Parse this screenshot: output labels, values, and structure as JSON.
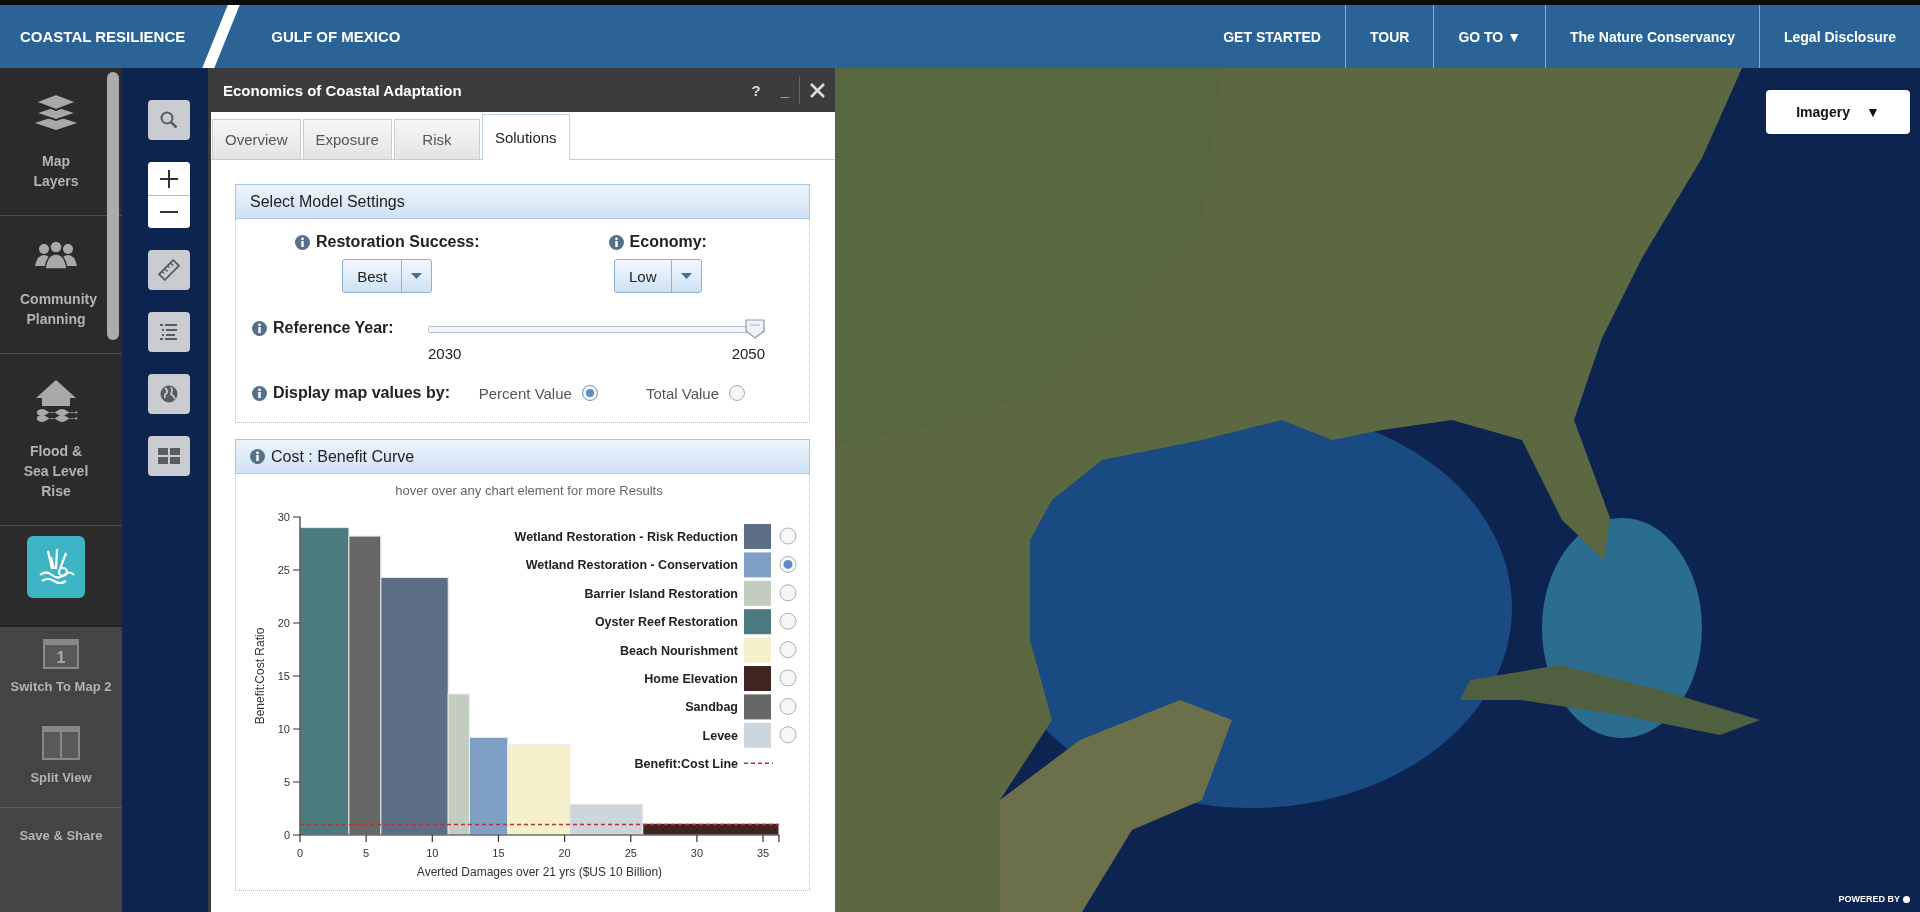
{
  "header": {
    "brand": "COASTAL RESILIENCE",
    "region": "GULF OF MEXICO",
    "nav": [
      {
        "label": "GET STARTED"
      },
      {
        "label": "TOUR"
      },
      {
        "label": "GO TO ▼"
      },
      {
        "label": "The Nature Conservancy"
      },
      {
        "label": "Legal Disclosure"
      }
    ]
  },
  "sidebar": {
    "items": [
      {
        "kind": "layers",
        "label": "Map Layers",
        "selected": false
      },
      {
        "kind": "people",
        "label": "Community Planning",
        "selected": false
      },
      {
        "kind": "flood",
        "label": "Flood & Sea Level Rise",
        "selected": false
      },
      {
        "kind": "coastal",
        "selected": true
      }
    ],
    "actions": [
      {
        "kind": "map_switch",
        "label": "Switch To Map 2",
        "badge": "1"
      },
      {
        "kind": "split",
        "label": "Split View"
      },
      {
        "kind": "text",
        "label": "Save & Share"
      }
    ]
  },
  "tools": [
    {
      "kind": "search"
    },
    {
      "kind": "zoom"
    },
    {
      "kind": "measure"
    },
    {
      "kind": "legend"
    },
    {
      "kind": "basemap"
    },
    {
      "kind": "grid"
    }
  ],
  "map": {
    "basemap_button": {
      "label": "Imagery",
      "caret": "▼"
    },
    "credit": "POWERED BY"
  },
  "panel": {
    "title": "Economics of Coastal Adaptation",
    "help": "?",
    "minimize": "_",
    "tabs": [
      {
        "label": "Overview",
        "selected": false
      },
      {
        "label": "Exposure",
        "selected": false
      },
      {
        "label": "Risk",
        "selected": false
      },
      {
        "label": "Solutions",
        "selected": true
      }
    ],
    "settings": {
      "title": "Select Model Settings",
      "restoration_success": {
        "label": "Restoration Success:",
        "value": "Best"
      },
      "economy": {
        "label": "Economy:",
        "value": "Low"
      },
      "reference_year": {
        "label": "Reference Year:",
        "min_label": "2030",
        "max_label": "2050",
        "level": 1
      },
      "display_by": {
        "label": "Display map values by:",
        "options": [
          {
            "label": "Percent Value",
            "selected": true
          },
          {
            "label": "Total Value",
            "selected": false
          }
        ]
      }
    },
    "chart": {
      "title": "Cost : Benefit Curve",
      "hint": "hover over any chart element for more Results",
      "chart_data": {
        "type": "bar",
        "xlabel": "Averted Damages over 21 yrs ($US 10 Billion)",
        "ylabel": "Benefit:Cost Ratio",
        "xlim": [
          0,
          36.2
        ],
        "ylim": [
          0,
          30
        ],
        "xticks": [
          0,
          5,
          10,
          15,
          20,
          25,
          30,
          35
        ],
        "yticks": [
          0,
          5,
          10,
          15,
          20,
          25,
          30
        ],
        "series": [
          {
            "name": "Wetland Restoration - Risk Reduction",
            "color": "#5b6e86",
            "x": [
              8.65
            ],
            "values": [
              24.3
            ]
          },
          {
            "name": "Wetland Restoration - Conservation",
            "color": "#809fc4",
            "x": [
              14.25
            ],
            "values": [
              9.2
            ]
          },
          {
            "name": "Barrier Island Restoration",
            "color": "#c3cdbf",
            "x": [
              12
            ],
            "values": [
              13.3
            ]
          },
          {
            "name": "Oyster Reef Restoration",
            "color": "#4b7b7f",
            "x": [
              1.85
            ],
            "values": [
              29
            ]
          },
          {
            "name": "Beach Nourishment",
            "color": "#f6f0cc",
            "x": [
              18.05
            ],
            "values": [
              8.5
            ]
          },
          {
            "name": "Home Elevation",
            "color": "#3f2520",
            "x": [
              31.05
            ],
            "values": [
              1.1
            ]
          },
          {
            "name": "Sandbag",
            "color": "#676767",
            "x": [
              4.9
            ],
            "values": [
              28.2
            ]
          },
          {
            "name": "Levee",
            "color": "#cdd5dd",
            "x": [
              23.15
            ],
            "values": [
              2.9
            ]
          }
        ],
        "ref_lines": [
          {
            "axis": "y",
            "value": 1,
            "label": "Benefit:Cost Line",
            "color": "#b8312f"
          }
        ],
        "legend": "right"
      },
      "radios": [
        {
          "selected": false
        },
        {
          "selected": true
        },
        {
          "selected": false
        },
        {
          "selected": false
        },
        {
          "selected": false
        },
        {
          "selected": false
        },
        {
          "selected": false
        },
        {
          "selected": false
        }
      ]
    }
  }
}
